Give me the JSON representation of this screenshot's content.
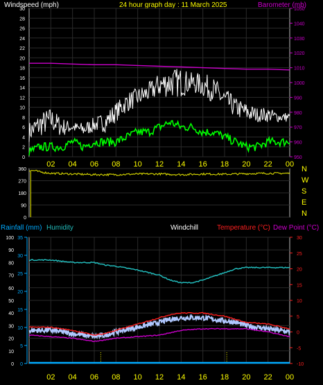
{
  "top_panel": {
    "title_left": "Windspeed (mph)",
    "title_center": "24 hour graph day : 11 March 2025",
    "title_right": "Barometer (mb)"
  },
  "middle_panel": {
    "compass_labels": [
      "N",
      "W",
      "S",
      "E",
      "N"
    ]
  },
  "bottom_panel": {
    "label_rain": "Rainfall (mm)",
    "label_humidity": "Humidity",
    "label_windchill": "Windchill",
    "label_temperature": "Temperature (°C)",
    "label_dewpoint": "Dew Point (°C)"
  },
  "colors": {
    "windspeed": "#ffffff",
    "gust_highlight": "#00ff00",
    "barometer": "#cc00cc",
    "wind_direction": "#cccc00",
    "rain": "#00aaff",
    "humidity": "#22bbbb",
    "temperature": "#ff2020",
    "dewpoint": "#cc00cc",
    "windchill": "#b0c8ff",
    "title_yellow": "#ffff00",
    "axis_white": "#ffffff"
  },
  "chart_data": [
    {
      "type": "line",
      "name": "windspeed-barometer",
      "x_ticks": [
        "02",
        "04",
        "06",
        "08",
        "10",
        "12",
        "14",
        "16",
        "18",
        "20",
        "22",
        "00"
      ],
      "y_left": {
        "ticks": [
          0,
          2,
          4,
          6,
          8,
          10,
          12,
          14,
          16,
          18,
          20,
          22,
          24,
          26,
          28,
          30
        ],
        "ylim": [
          0,
          30
        ]
      },
      "y_right": {
        "ticks": [
          950,
          960,
          970,
          980,
          990,
          1000,
          1010,
          1020,
          1030,
          1040,
          1050
        ],
        "ylim": [
          950,
          1050
        ]
      },
      "series": [
        {
          "name": "Windspeed",
          "axis": "left",
          "hours": [
            0,
            1,
            2,
            3,
            4,
            5,
            6,
            7,
            8,
            9,
            10,
            11,
            12,
            13,
            14,
            15,
            16,
            17,
            18,
            19,
            20,
            21,
            22,
            23,
            24
          ],
          "values": [
            3,
            4,
            5,
            4,
            5,
            4,
            5,
            5,
            7,
            9,
            10,
            11,
            12,
            12,
            12,
            13,
            12,
            11,
            9,
            8,
            7,
            7,
            7,
            7,
            7
          ]
        },
        {
          "name": "Windspeed peaks",
          "axis": "left",
          "hours": [
            0,
            1,
            2,
            3,
            4,
            5,
            6,
            7,
            8,
            9,
            10,
            11,
            12,
            13,
            14,
            15,
            16,
            17,
            18,
            19,
            20,
            21,
            22,
            23,
            24
          ],
          "values": [
            7,
            9,
            10,
            8,
            7,
            7,
            8,
            9,
            11,
            13,
            14,
            15,
            17,
            18,
            18,
            17,
            17,
            16,
            14,
            12,
            11,
            10,
            10,
            9,
            9
          ]
        },
        {
          "name": "Wind gust",
          "axis": "left",
          "hours": [
            0,
            1,
            2,
            3,
            4,
            5,
            6,
            7,
            8,
            9,
            10,
            11,
            12,
            13,
            14,
            15,
            16,
            17,
            18,
            19,
            20,
            21,
            22,
            23,
            24
          ],
          "values": [
            1,
            2,
            2,
            2,
            3,
            2,
            3,
            3,
            3,
            4,
            5,
            5,
            6,
            7,
            6,
            6,
            5,
            5,
            4,
            3,
            2,
            2,
            3,
            3,
            3
          ]
        },
        {
          "name": "Barometer",
          "axis": "right",
          "hours": [
            0,
            2,
            4,
            6,
            8,
            10,
            12,
            14,
            16,
            18,
            20,
            22,
            24
          ],
          "values": [
            1013,
            1013,
            1012.5,
            1012,
            1012,
            1011.5,
            1011,
            1010.5,
            1010,
            1009.5,
            1009,
            1009,
            1008.5
          ]
        }
      ]
    },
    {
      "type": "line",
      "name": "wind-direction",
      "y_left": {
        "ticks": [
          0,
          90,
          180,
          270,
          360
        ],
        "ylim": [
          0,
          360
        ]
      },
      "hours": [
        0,
        0.5,
        1,
        2,
        4,
        6,
        8,
        10,
        12,
        14,
        16,
        18,
        20,
        22,
        24
      ],
      "values": [
        345,
        345,
        335,
        325,
        320,
        315,
        315,
        320,
        320,
        315,
        320,
        318,
        322,
        325,
        325
      ]
    },
    {
      "type": "line",
      "name": "rain-humidity-temperature",
      "x_ticks": [
        "02",
        "04",
        "06",
        "08",
        "10",
        "12",
        "14",
        "16",
        "18",
        "20",
        "22",
        "00"
      ],
      "y_left": {
        "ticks": [
          0,
          10,
          20,
          30,
          40,
          50,
          60,
          70,
          80,
          90,
          100
        ],
        "ylim": [
          0,
          100
        ]
      },
      "y_rain": {
        "ticks": [
          0,
          5,
          10,
          15,
          20,
          25,
          30,
          35
        ],
        "ylim": [
          0,
          35
        ]
      },
      "y_right": {
        "ticks": [
          -10,
          -5,
          0,
          5,
          10,
          15,
          20,
          25,
          30
        ],
        "ylim": [
          -10,
          30
        ]
      },
      "series": [
        {
          "name": "Humidity",
          "axis": "left",
          "hours": [
            0,
            2,
            4,
            6,
            7,
            8,
            10,
            12,
            13,
            14,
            15,
            16,
            17,
            18,
            19,
            20,
            22,
            24
          ],
          "values": [
            82,
            82,
            80,
            80,
            78,
            77,
            74,
            70,
            66,
            64,
            64,
            66,
            69,
            72,
            75,
            76,
            76,
            76
          ]
        },
        {
          "name": "Temperature",
          "axis": "right",
          "hours": [
            0,
            2,
            4,
            6,
            7,
            8,
            10,
            12,
            13,
            14,
            15,
            16,
            17,
            18,
            19,
            20,
            22,
            24
          ],
          "values": [
            1.5,
            1.5,
            0.5,
            -1,
            -0.5,
            0.5,
            2.5,
            4.5,
            5.5,
            6,
            6,
            6,
            5.5,
            5,
            4,
            3,
            2.5,
            1
          ]
        },
        {
          "name": "Windchill",
          "axis": "right",
          "hours": [
            0,
            2,
            4,
            6,
            7,
            8,
            10,
            12,
            13,
            14,
            15,
            16,
            17,
            18,
            19,
            20,
            22,
            24
          ],
          "values": [
            0.5,
            0.5,
            -0.5,
            -1.5,
            -1,
            0,
            1.5,
            3,
            4,
            4.5,
            4.5,
            4.5,
            4,
            3.5,
            3,
            2,
            1,
            0
          ]
        },
        {
          "name": "Dew Point",
          "axis": "right",
          "hours": [
            0,
            2,
            4,
            6,
            7,
            8,
            10,
            12,
            14,
            16,
            18,
            20,
            22,
            24
          ],
          "values": [
            -1,
            -1.5,
            -2,
            -3,
            -2.5,
            -2,
            -1.5,
            -1,
            0.5,
            1,
            1,
            1,
            0,
            -1.5
          ]
        },
        {
          "name": "Rainfall",
          "axis": "rain",
          "hours": [
            0,
            24
          ],
          "values": [
            0,
            0
          ]
        }
      ],
      "markers_hours": [
        6.6,
        18.2
      ]
    }
  ]
}
